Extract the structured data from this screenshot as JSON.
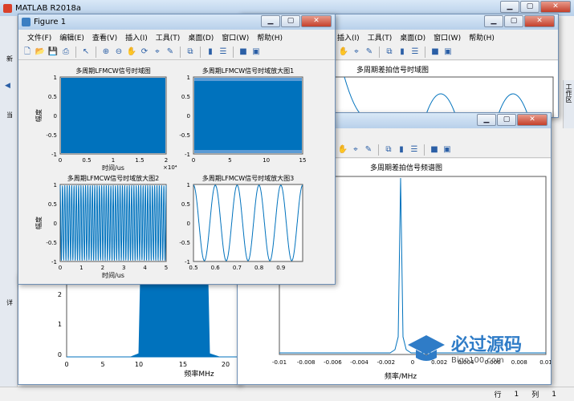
{
  "matlab": {
    "title": "MATLAB R2018a",
    "status": {
      "row_label": "行",
      "row_value": "1",
      "col_label": "列",
      "col_value": "1"
    },
    "left_labels": {
      "new": "新",
      "current": "当",
      "details": "详",
      "workspace": "工作区"
    }
  },
  "menus": [
    "文件(F)",
    "编辑(E)",
    "查看(V)",
    "插入(I)",
    "工具(T)",
    "桌面(D)",
    "窗口(W)",
    "帮助(H)"
  ],
  "menus_partial": [
    "插入(I)",
    "工具(T)",
    "桌面(D)",
    "窗口(W)",
    "帮助(H)"
  ],
  "figure1": {
    "title": "Figure 1",
    "plots": [
      {
        "title": "多周期LFMCW信号时域图",
        "xlabel": "时间/us",
        "ylabel": "幅度",
        "xticks": [
          "0",
          "0.5",
          "1",
          "1.5",
          "2"
        ],
        "yticks": [
          "1",
          "0.5",
          "0",
          "-0.5",
          "-1"
        ],
        "exponent": "×10⁴"
      },
      {
        "title": "多周期LFMCW信号时域放大图1",
        "xlabel": "",
        "ylabel": "",
        "xticks": [
          "0",
          "5",
          "10",
          "15"
        ],
        "yticks": [
          "1",
          "0.5",
          "0",
          "-0.5",
          "-1"
        ]
      },
      {
        "title": "多周期LFMCW信号时域放大图2",
        "xlabel": "时间/us",
        "ylabel": "幅度",
        "xticks": [
          "0",
          "1",
          "2",
          "3",
          "4",
          "5"
        ],
        "yticks": [
          "1",
          "0.5",
          "0",
          "-0.5",
          "-1"
        ]
      },
      {
        "title": "多周期LFMCW信号时域放大图3",
        "xlabel": "",
        "ylabel": "",
        "xticks": [
          "0.5",
          "0.6",
          "0.7",
          "0.8",
          "0.9"
        ],
        "yticks": [
          "1",
          "0.5",
          "0",
          "-0.5",
          "-1"
        ]
      }
    ]
  },
  "figure2": {
    "title": "多周期差拍信号时域图"
  },
  "figure3": {
    "title": "多周期差拍信号频谱图",
    "xlabel": "频率/MHz",
    "xticks": [
      "-0.01",
      "-0.008",
      "-0.006",
      "-0.004",
      "-0.002",
      "0",
      "0.002",
      "0.004",
      "0.006",
      "0.008",
      "0.01"
    ]
  },
  "figure4": {
    "xlabel": "频率MHz",
    "xticks": [
      "0",
      "5",
      "10",
      "15",
      "20"
    ],
    "yticks": [
      "2",
      "1",
      "0"
    ]
  },
  "watermark": {
    "main": "必过源码",
    "sub": "Bigo100.com"
  },
  "colors": {
    "line": "#0072BD",
    "accent": "#2b5fa6"
  },
  "chart_data": [
    {
      "type": "area",
      "title": "多周期LFMCW信号时域图",
      "xlabel": "时间/us",
      "ylabel": "幅度",
      "xlim": [
        0,
        20000
      ],
      "ylim": [
        -1,
        1
      ],
      "note_values": "dense oscillation filling -1..1"
    },
    {
      "type": "line",
      "title": "多周期LFMCW信号时域放大图1",
      "xlim": [
        0,
        15
      ],
      "ylim": [
        -1,
        1
      ]
    },
    {
      "type": "line",
      "title": "多周期LFMCW信号时域放大图2",
      "xlabel": "时间/us",
      "ylabel": "幅度",
      "xlim": [
        0,
        5
      ],
      "ylim": [
        -1,
        1
      ],
      "cycles": 46
    },
    {
      "type": "line",
      "title": "多周期LFMCW信号时域放大图3",
      "xlim": [
        0.5,
        1.0
      ],
      "ylim": [
        -1,
        1
      ],
      "cycles": 5
    },
    {
      "type": "line",
      "title": "多周期差拍信号频谱图",
      "xlabel": "频率/MHz",
      "xlim": [
        -0.01,
        0.01
      ],
      "peak_x": 0.0
    },
    {
      "type": "area",
      "xlabel": "频率MHz",
      "xlim": [
        0,
        23
      ],
      "ylim": [
        0,
        2.5
      ],
      "band": [
        11,
        17
      ]
    }
  ]
}
